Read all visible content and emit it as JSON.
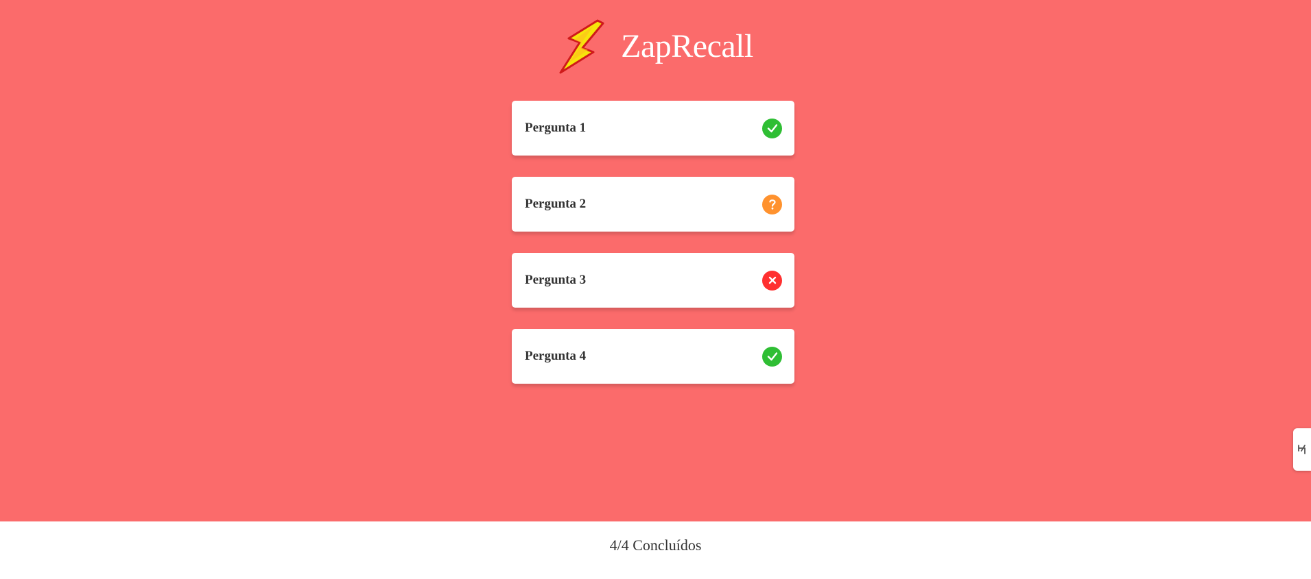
{
  "header": {
    "title": "ZapRecall",
    "logo_icon": "lightning-bolt-icon"
  },
  "cards": [
    {
      "label": "Pergunta 1",
      "status": "correct",
      "icon": "check-circle-icon",
      "color": "#2FBE34"
    },
    {
      "label": "Pergunta 2",
      "status": "almost",
      "icon": "help-circle-icon",
      "color": "#FF922E"
    },
    {
      "label": "Pergunta 3",
      "status": "wrong",
      "icon": "close-circle-icon",
      "color": "#FF3030"
    },
    {
      "label": "Pergunta 4",
      "status": "correct",
      "icon": "check-circle-icon",
      "color": "#2FBE34"
    }
  ],
  "footer": {
    "progress_text": "4/4 Concluídos"
  },
  "side_tab": {
    "icon": "extension-tab-icon"
  },
  "colors": {
    "background": "#FB6B6B",
    "card": "#FFFFFF",
    "text": "#333333",
    "correct": "#2FBE34",
    "almost": "#FF922E",
    "wrong": "#FF3030"
  }
}
